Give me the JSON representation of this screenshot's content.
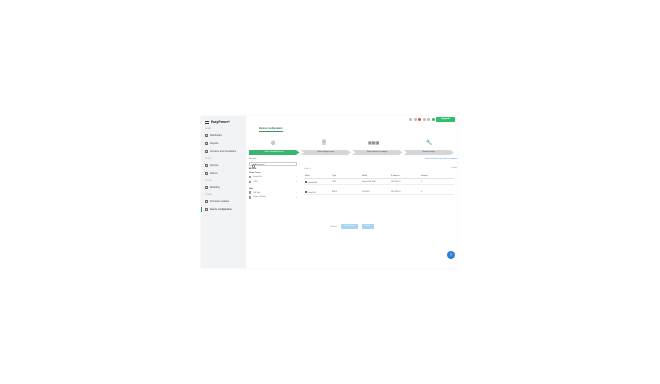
{
  "brand": {
    "logo_text": "EasyPower+"
  },
  "sidebar": {
    "sections": [
      {
        "label": "HOME"
      },
      {
        "label": "SITES"
      },
      {
        "label": "TOOLS"
      },
      {
        "label": "OTHER"
      }
    ],
    "items": [
      {
        "label": "Dashboard"
      },
      {
        "label": "Reports"
      },
      {
        "label": "Services and Operations"
      },
      {
        "label": "Devices"
      },
      {
        "label": "Alarms"
      },
      {
        "label": "Modeling"
      },
      {
        "label": "Firmware updates"
      },
      {
        "label": "Device configuration"
      }
    ]
  },
  "topbar": {
    "upgrade_label": "Upgrade"
  },
  "page": {
    "title": "Device configuration"
  },
  "wizard": {
    "steps": [
      {
        "label": "Select compatible devices",
        "icon": "target-icon"
      },
      {
        "label": "Select settings to write",
        "icon": "document-icon"
      },
      {
        "label": "Select devices to configure",
        "icon": "devices-icon"
      },
      {
        "label": "Review changes",
        "icon": "wrench-icon"
      }
    ]
  },
  "filters": {
    "title": "Devices",
    "select_value": "All devices",
    "groups": [
      {
        "title": "BLUDH"
      },
      {
        "title": "Model Name",
        "items": [
          "Easy Pin1",
          "UPS"
        ]
      },
      {
        "title": "Site",
        "items": [
          "Hill Site",
          "Home S4 Site"
        ]
      }
    ]
  },
  "table": {
    "link_text": "Select the devices you wish to configure",
    "search_placeholder": "Search",
    "count": "2 items",
    "columns": [
      "Name",
      "Type",
      "Model",
      "IP address",
      "Settings"
    ],
    "rows": [
      [
        "ups/node04",
        "UPS",
        "Smart-UPS 1500",
        "192.168.1.5",
        "0"
      ],
      [
        "Easy Pin1",
        "EPDU",
        "1P/16/20",
        "192.168.1.6",
        "0"
      ]
    ]
  },
  "footer": {
    "cancel": "Cancel",
    "previous": "< Previous",
    "next": "Next"
  },
  "help": {
    "label": "?"
  },
  "colors": {
    "accent": "#3ab56c",
    "primary": "#2f7fd8",
    "upgrade": "#2ec06b"
  }
}
